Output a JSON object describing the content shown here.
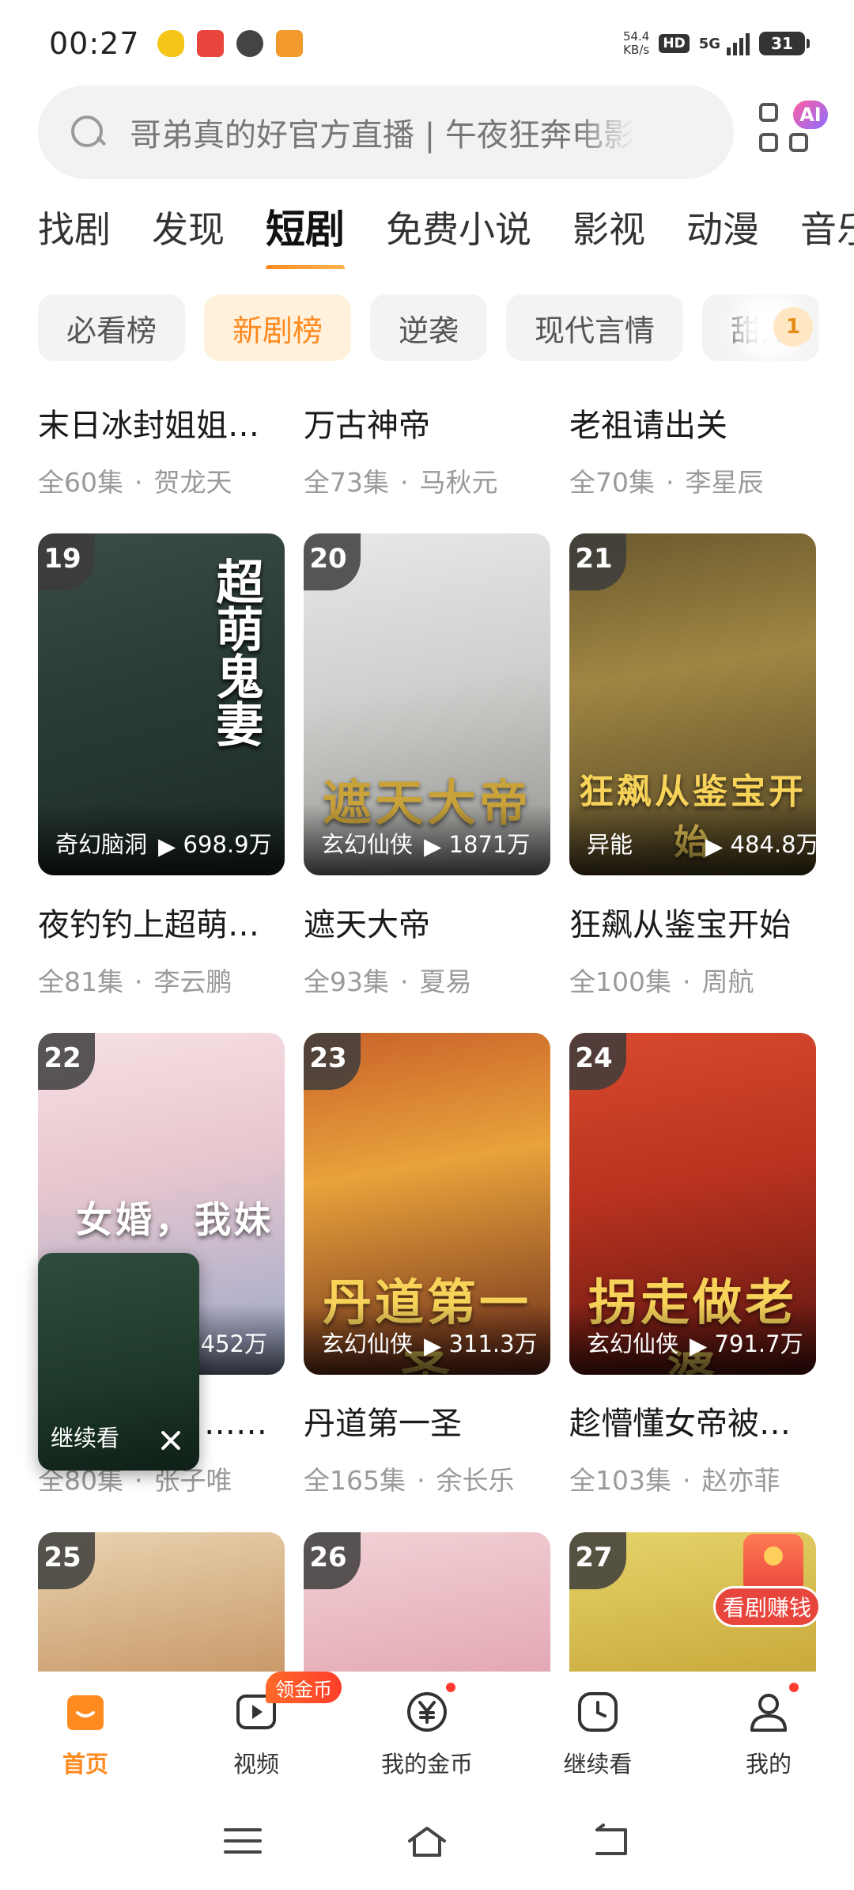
{
  "status": {
    "time": "00:27",
    "net_speed_value": "54.4",
    "net_speed_unit": "KB/s",
    "hd": "HD",
    "network": "5G",
    "battery": "31"
  },
  "search": {
    "placeholder": "哥弟真的好官方直播 | 午夜狂奔电影"
  },
  "ai_badge": "AI",
  "tabs": [
    "找剧",
    "发现",
    "短剧",
    "免费小说",
    "影视",
    "动漫",
    "音乐"
  ],
  "active_tab": "短剧",
  "chips": [
    "必看榜",
    "新剧榜",
    "逆袭",
    "现代言情",
    "甜宠"
  ],
  "active_chip": "新剧榜",
  "chip_count": "1",
  "row0": [
    {
      "title": "末日冰封姐姐…",
      "episodes": "全60集",
      "actor": "贺龙天"
    },
    {
      "title": "万古神帝",
      "episodes": "全73集",
      "actor": "马秋元"
    },
    {
      "title": "老祖请出关",
      "episodes": "全70集",
      "actor": "李星辰"
    }
  ],
  "cards": [
    {
      "rank": "19",
      "genre": "奇幻脑洞",
      "plays": "698.9万",
      "poster_title": "超萌鬼妻",
      "title": "夜钓钓上超萌…",
      "episodes": "全81集",
      "actor": "李云鹏"
    },
    {
      "rank": "20",
      "genre": "玄幻仙侠",
      "plays": "1871万",
      "poster_title": "遮天大帝",
      "title": "遮天大帝",
      "episodes": "全93集",
      "actor": "夏易"
    },
    {
      "rank": "21",
      "genre": "异能",
      "plays": "484.8万",
      "poster_title": "狂飙从鉴宝开始",
      "title": "狂飙从鉴宝开始",
      "episodes": "全100集",
      "actor": "周航"
    },
    {
      "rank": "22",
      "genre": "",
      "plays": "452万",
      "poster_title": "女婚，我妹",
      "title": "…高…",
      "episodes": "全80集",
      "actor": "张子唯"
    },
    {
      "rank": "23",
      "genre": "玄幻仙侠",
      "plays": "311.3万",
      "poster_title": "丹道第一圣",
      "title": "丹道第一圣",
      "episodes": "全165集",
      "actor": "余长乐"
    },
    {
      "rank": "24",
      "genre": "玄幻仙侠",
      "plays": "791.7万",
      "poster_title": "拐走做老婆",
      "title": "趁懵懂女帝被…",
      "episodes": "全103集",
      "actor": "赵亦菲"
    },
    {
      "rank": "25"
    },
    {
      "rank": "26"
    },
    {
      "rank": "27"
    }
  ],
  "mini_player": {
    "label": "继续看"
  },
  "promo_badge": "看剧赚钱",
  "bottom_nav": [
    {
      "label": "首页",
      "icon": "home-icon"
    },
    {
      "label": "视频",
      "icon": "video-icon",
      "badge": "领金币"
    },
    {
      "label": "我的金币",
      "icon": "coin-icon"
    },
    {
      "label": "继续看",
      "icon": "clock-icon"
    },
    {
      "label": "我的",
      "icon": "profile-icon"
    }
  ],
  "colors": {
    "accent": "#ff8a1f",
    "chip_active_bg": "#fff1dc",
    "badge_red": "#e8453c"
  }
}
